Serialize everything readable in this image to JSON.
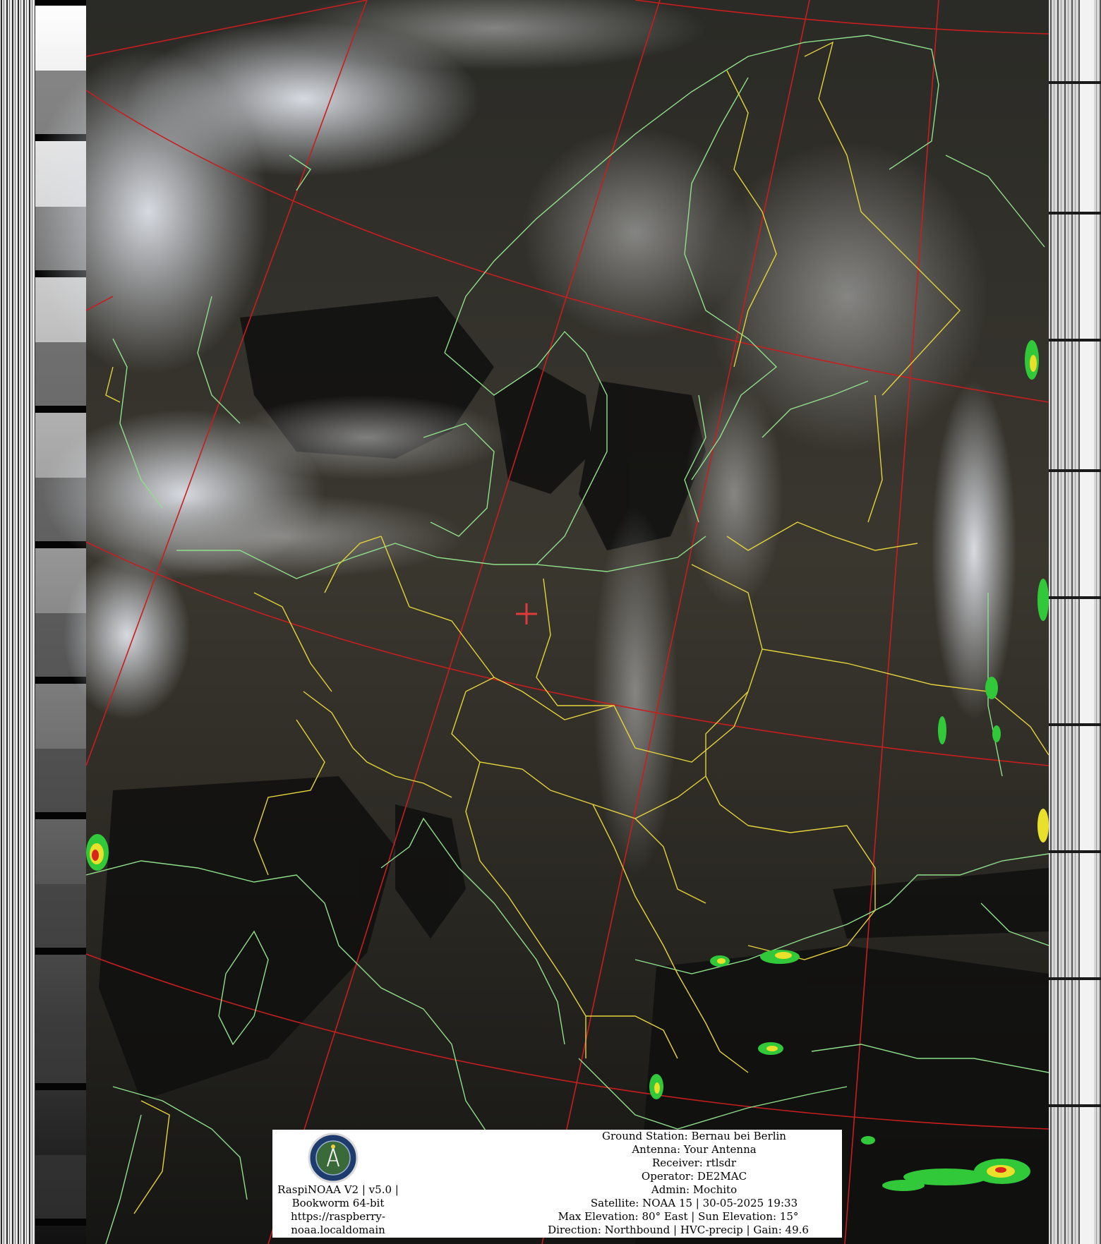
{
  "software": {
    "line1": "RaspiNOAA V2 | v5.0 |",
    "line2": "Bookworm 64-bit",
    "line3": "https://raspberry-",
    "line4": "noaa.localdomain"
  },
  "station": {
    "ground_station": "Ground Station: Bernau bei Berlin",
    "antenna": "Antenna: Your Antenna",
    "receiver": "Receiver: rtlsdr",
    "operator": "Operator: DE2MAC",
    "admin": "Admin: Mochito",
    "satellite": "Satellite: NOAA 15 | 30-05-2025 19:33",
    "elevation": "Max Elevation: 80° East | Sun Elevation: 15°",
    "direction": "Direction: Northbound | HVC-precip | Gain: 49.6"
  },
  "icons": {
    "logo": "satellite-station-logo-icon",
    "marker": "ground-station-cross-icon"
  },
  "colors": {
    "graticule": "#c81e1e",
    "coastline": "#8ee08a",
    "borders": "#e6d23a",
    "marker": "#e23a3a",
    "precip_light": "#31c83a",
    "precip_mid": "#e8e02a",
    "precip_heavy": "#d8281e"
  }
}
